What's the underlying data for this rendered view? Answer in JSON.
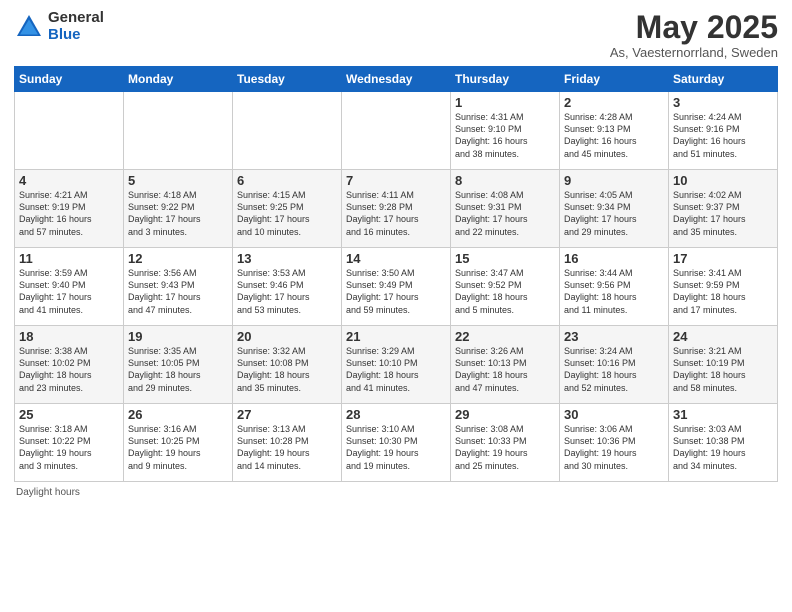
{
  "header": {
    "logo_general": "General",
    "logo_blue": "Blue",
    "title": "May 2025",
    "subtitle": "As, Vaesternorrland, Sweden"
  },
  "footer": {
    "daylight_label": "Daylight hours"
  },
  "columns": [
    "Sunday",
    "Monday",
    "Tuesday",
    "Wednesday",
    "Thursday",
    "Friday",
    "Saturday"
  ],
  "weeks": [
    [
      {
        "day": "",
        "info": ""
      },
      {
        "day": "",
        "info": ""
      },
      {
        "day": "",
        "info": ""
      },
      {
        "day": "",
        "info": ""
      },
      {
        "day": "1",
        "info": "Sunrise: 4:31 AM\nSunset: 9:10 PM\nDaylight: 16 hours\nand 38 minutes."
      },
      {
        "day": "2",
        "info": "Sunrise: 4:28 AM\nSunset: 9:13 PM\nDaylight: 16 hours\nand 45 minutes."
      },
      {
        "day": "3",
        "info": "Sunrise: 4:24 AM\nSunset: 9:16 PM\nDaylight: 16 hours\nand 51 minutes."
      }
    ],
    [
      {
        "day": "4",
        "info": "Sunrise: 4:21 AM\nSunset: 9:19 PM\nDaylight: 16 hours\nand 57 minutes."
      },
      {
        "day": "5",
        "info": "Sunrise: 4:18 AM\nSunset: 9:22 PM\nDaylight: 17 hours\nand 3 minutes."
      },
      {
        "day": "6",
        "info": "Sunrise: 4:15 AM\nSunset: 9:25 PM\nDaylight: 17 hours\nand 10 minutes."
      },
      {
        "day": "7",
        "info": "Sunrise: 4:11 AM\nSunset: 9:28 PM\nDaylight: 17 hours\nand 16 minutes."
      },
      {
        "day": "8",
        "info": "Sunrise: 4:08 AM\nSunset: 9:31 PM\nDaylight: 17 hours\nand 22 minutes."
      },
      {
        "day": "9",
        "info": "Sunrise: 4:05 AM\nSunset: 9:34 PM\nDaylight: 17 hours\nand 29 minutes."
      },
      {
        "day": "10",
        "info": "Sunrise: 4:02 AM\nSunset: 9:37 PM\nDaylight: 17 hours\nand 35 minutes."
      }
    ],
    [
      {
        "day": "11",
        "info": "Sunrise: 3:59 AM\nSunset: 9:40 PM\nDaylight: 17 hours\nand 41 minutes."
      },
      {
        "day": "12",
        "info": "Sunrise: 3:56 AM\nSunset: 9:43 PM\nDaylight: 17 hours\nand 47 minutes."
      },
      {
        "day": "13",
        "info": "Sunrise: 3:53 AM\nSunset: 9:46 PM\nDaylight: 17 hours\nand 53 minutes."
      },
      {
        "day": "14",
        "info": "Sunrise: 3:50 AM\nSunset: 9:49 PM\nDaylight: 17 hours\nand 59 minutes."
      },
      {
        "day": "15",
        "info": "Sunrise: 3:47 AM\nSunset: 9:52 PM\nDaylight: 18 hours\nand 5 minutes."
      },
      {
        "day": "16",
        "info": "Sunrise: 3:44 AM\nSunset: 9:56 PM\nDaylight: 18 hours\nand 11 minutes."
      },
      {
        "day": "17",
        "info": "Sunrise: 3:41 AM\nSunset: 9:59 PM\nDaylight: 18 hours\nand 17 minutes."
      }
    ],
    [
      {
        "day": "18",
        "info": "Sunrise: 3:38 AM\nSunset: 10:02 PM\nDaylight: 18 hours\nand 23 minutes."
      },
      {
        "day": "19",
        "info": "Sunrise: 3:35 AM\nSunset: 10:05 PM\nDaylight: 18 hours\nand 29 minutes."
      },
      {
        "day": "20",
        "info": "Sunrise: 3:32 AM\nSunset: 10:08 PM\nDaylight: 18 hours\nand 35 minutes."
      },
      {
        "day": "21",
        "info": "Sunrise: 3:29 AM\nSunset: 10:10 PM\nDaylight: 18 hours\nand 41 minutes."
      },
      {
        "day": "22",
        "info": "Sunrise: 3:26 AM\nSunset: 10:13 PM\nDaylight: 18 hours\nand 47 minutes."
      },
      {
        "day": "23",
        "info": "Sunrise: 3:24 AM\nSunset: 10:16 PM\nDaylight: 18 hours\nand 52 minutes."
      },
      {
        "day": "24",
        "info": "Sunrise: 3:21 AM\nSunset: 10:19 PM\nDaylight: 18 hours\nand 58 minutes."
      }
    ],
    [
      {
        "day": "25",
        "info": "Sunrise: 3:18 AM\nSunset: 10:22 PM\nDaylight: 19 hours\nand 3 minutes."
      },
      {
        "day": "26",
        "info": "Sunrise: 3:16 AM\nSunset: 10:25 PM\nDaylight: 19 hours\nand 9 minutes."
      },
      {
        "day": "27",
        "info": "Sunrise: 3:13 AM\nSunset: 10:28 PM\nDaylight: 19 hours\nand 14 minutes."
      },
      {
        "day": "28",
        "info": "Sunrise: 3:10 AM\nSunset: 10:30 PM\nDaylight: 19 hours\nand 19 minutes."
      },
      {
        "day": "29",
        "info": "Sunrise: 3:08 AM\nSunset: 10:33 PM\nDaylight: 19 hours\nand 25 minutes."
      },
      {
        "day": "30",
        "info": "Sunrise: 3:06 AM\nSunset: 10:36 PM\nDaylight: 19 hours\nand 30 minutes."
      },
      {
        "day": "31",
        "info": "Sunrise: 3:03 AM\nSunset: 10:38 PM\nDaylight: 19 hours\nand 34 minutes."
      }
    ]
  ]
}
